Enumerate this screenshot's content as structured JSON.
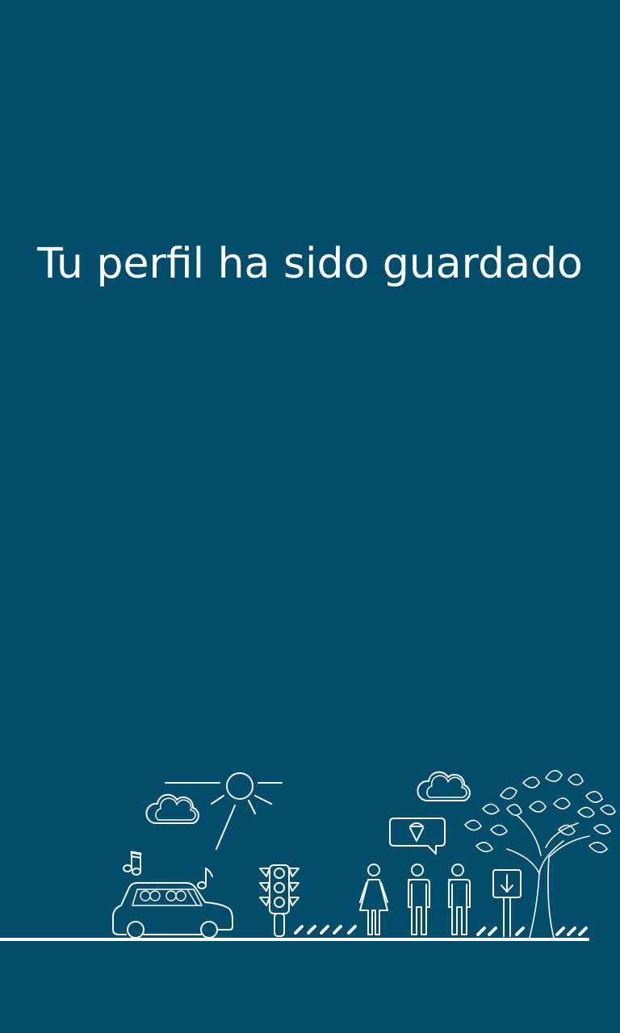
{
  "screen": {
    "message": "Tu perfil ha sido guardado"
  },
  "colors": {
    "background": "#024d6c",
    "foreground": "#ffffff"
  },
  "illustration": {
    "icons": [
      "sun-icon",
      "cloud-icon",
      "music-note-icon",
      "car-icon",
      "traffic-light-icon",
      "pedestrians-icon",
      "ice-cream-speech-bubble-icon",
      "bus-stop-sign-icon",
      "tree-icon"
    ]
  }
}
